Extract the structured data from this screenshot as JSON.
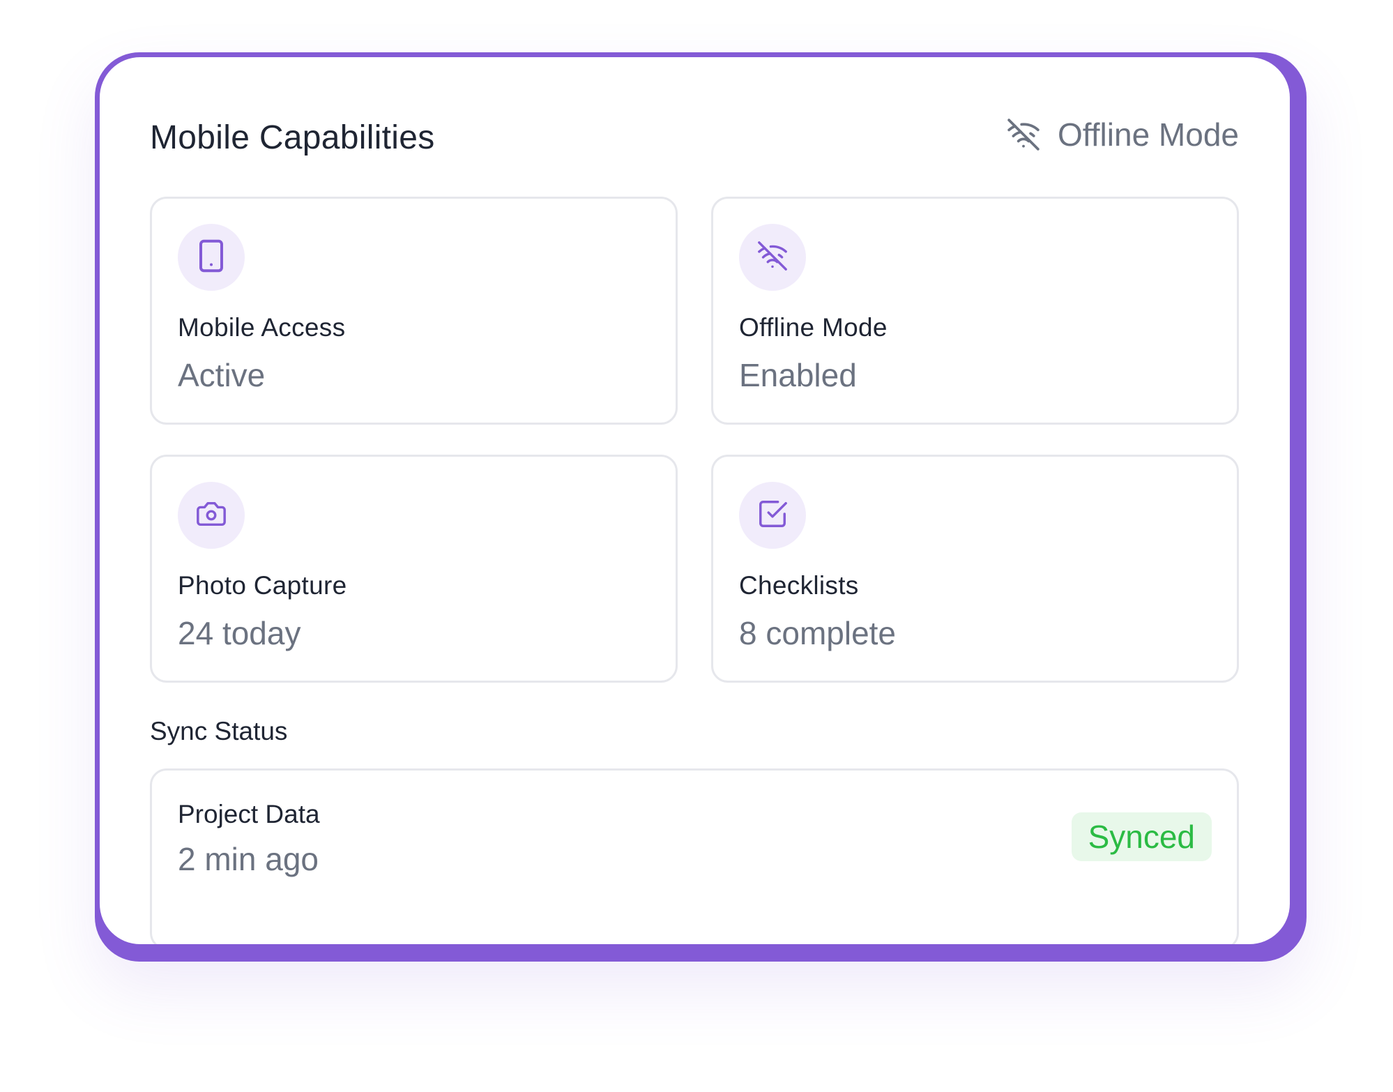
{
  "panel": {
    "title": "Mobile Capabilities",
    "header_status": {
      "label": "Offline Mode",
      "icon": "wifi-off-icon"
    }
  },
  "tiles": [
    {
      "icon": "tablet-icon",
      "label": "Mobile Access",
      "value": "Active"
    },
    {
      "icon": "wifi-off-icon",
      "label": "Offline Mode",
      "value": "Enabled"
    },
    {
      "icon": "camera-icon",
      "label": "Photo Capture",
      "value": "24 today"
    },
    {
      "icon": "check-square-icon",
      "label": "Checklists",
      "value": "8 complete"
    }
  ],
  "sync": {
    "section_title": "Sync Status",
    "items": [
      {
        "name": "Project Data",
        "time": "2 min ago",
        "status": "Synced"
      }
    ]
  },
  "colors": {
    "accent": "#835ad6",
    "icon_bg": "#f1ecfb",
    "success_text": "#2bbb44",
    "success_bg": "#e8f8ea",
    "text_primary": "#1f2533",
    "text_secondary": "#6b7280",
    "border": "#e6e7ec"
  }
}
